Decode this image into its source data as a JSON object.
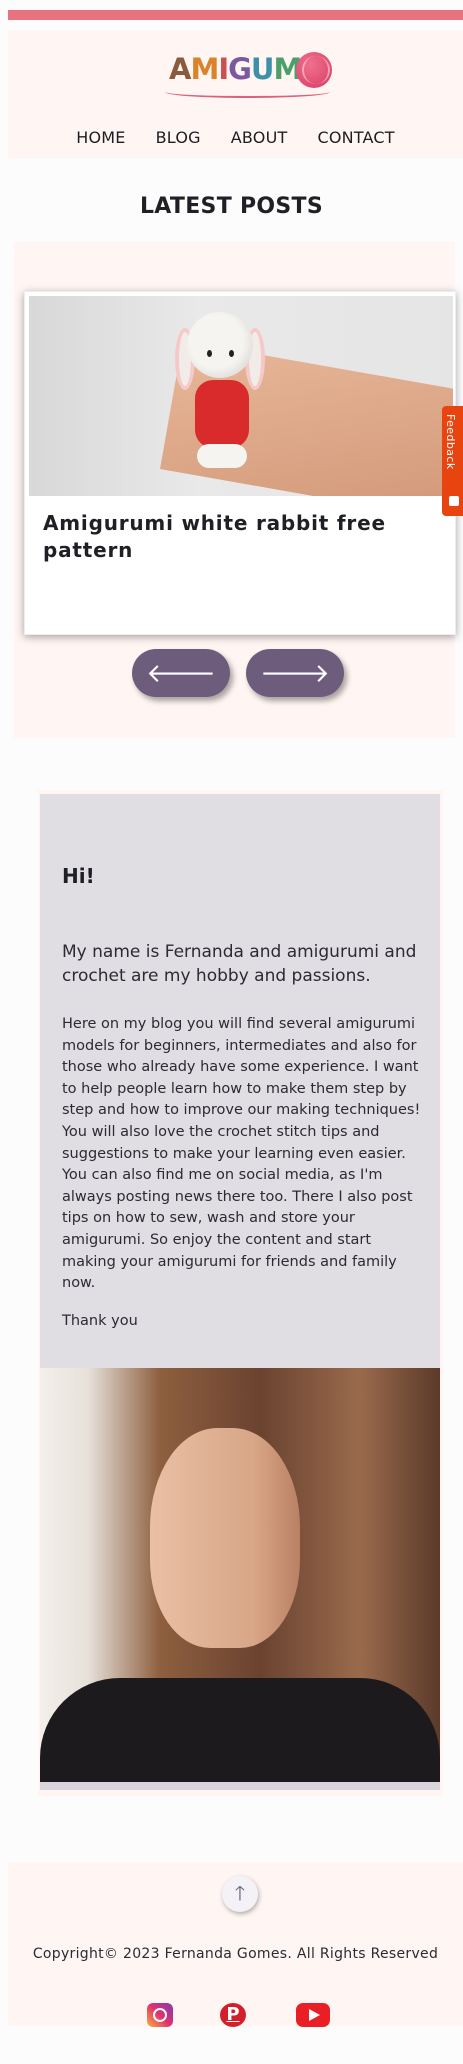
{
  "header": {
    "logo_text": [
      "A",
      "M",
      "I",
      "G",
      "U",
      "ME"
    ],
    "nav": [
      "HOME",
      "BLOG",
      "ABOUT",
      "CONTACT"
    ]
  },
  "latest": {
    "title": "LATEST POSTS",
    "post_title": "Amigurumi white rabbit free pattern",
    "prev_arrow": "🡐",
    "next_arrow": "🡒"
  },
  "feedback": {
    "label": "Feedback"
  },
  "about": {
    "greeting": "Hi!",
    "intro": "My name is Fernanda and amigurumi and crochet are my hobby and passions.",
    "body": "Here on my blog you will find several amigurumi models for beginners, intermediates and also for those who already have some experience. I want to help people learn how to make them step by step and how to improve our making techniques! You will also love the crochet stitch tips and suggestions to make your learning even easier. You can also find me on social media, as I'm always posting news there too. There I also post tips on how to sew, wash and store your amigurumi. So enjoy the content and start making your amigurumi for friends and family now.",
    "thanks": "Thank you"
  },
  "footer": {
    "back_to_top": "🡑",
    "copyright": "Copyright© 2023 Fernanda Gomes. All Rights Reserved",
    "pinterest_letter": "P",
    "social_icons": [
      "instagram-icon",
      "pinterest-icon",
      "youtube-icon"
    ]
  },
  "colors": {
    "accent_bar": "#e8727e",
    "section_bg": "#fff5f2",
    "button": "#6e5c7d",
    "about_box": "#e0dde3",
    "feedback": "#e8440f"
  }
}
